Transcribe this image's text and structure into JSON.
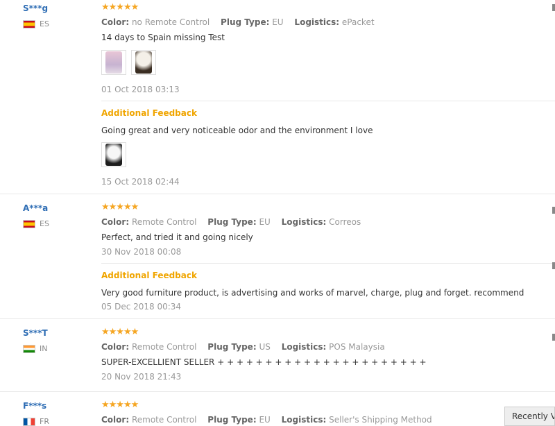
{
  "labels": {
    "color": "Color:",
    "plug_type": "Plug Type:",
    "logistics": "Logistics:",
    "additional_feedback": "Additional Feedback"
  },
  "reviews": [
    {
      "user": "S***g",
      "country": "ES",
      "stars": "★★★★★",
      "color": "no Remote Control",
      "plug_type": "EU",
      "logistics": "ePacket",
      "text": "14 days to Spain missing Test",
      "photo_count": 2,
      "date": "01 Oct 2018 03:13",
      "additional": {
        "text": "Going great and very noticeable odor and the environment I love",
        "photo_count": 1,
        "date": "15 Oct 2018 02:44"
      }
    },
    {
      "user": "A***a",
      "country": "ES",
      "stars": "★★★★★",
      "color": "Remote Control",
      "plug_type": "EU",
      "logistics": "Correos",
      "text": "Perfect, and tried it and going nicely",
      "date": "30 Nov 2018 00:08",
      "additional": {
        "text": "Very good furniture product, is advertising and works of marvel, charge, plug and forget. recommend",
        "date": "05 Dec 2018 00:34"
      }
    },
    {
      "user": "S***T",
      "country": "IN",
      "stars": "★★★★★",
      "color": "Remote Control",
      "plug_type": "US",
      "logistics": "POS Malaysia",
      "text": "SUPER-EXCELLIENT SELLER + + + + + + + + + + + + + + + + + + + + + +",
      "date": "20 Nov 2018 21:43"
    },
    {
      "user": "F***s",
      "country": "FR",
      "stars": "★★★★★",
      "color": "Remote Control",
      "plug_type": "EU",
      "logistics": "Seller's Shipping Method"
    }
  ],
  "recently_viewed": "Recently Viewed",
  "colors": {
    "user": "#2e6db4",
    "stars": "#f5a623",
    "additional": "#f0a500"
  }
}
